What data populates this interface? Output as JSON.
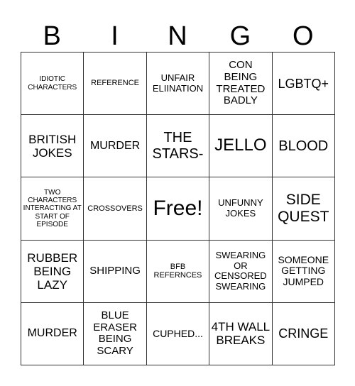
{
  "header": [
    "B",
    "I",
    "N",
    "G",
    "O"
  ],
  "rows": [
    [
      "IDIOTIC CHARACTERS",
      "REFERENCE",
      "UNFAIR ELIINATION",
      "CON BEING TREATED BADLY",
      "LGBTQ+"
    ],
    [
      "BRITISH JOKES",
      "MURDER",
      "THE STARS-",
      "JELLO",
      "BLOOD"
    ],
    [
      "TWO CHARACTERS INTERACTING AT START OF EPISODE",
      "CROSSOVERS",
      "Free!",
      "UNFUNNY JOKES",
      "SIDE QUEST"
    ],
    [
      "RUBBER BEING LAZY",
      "SHIPPING",
      "BFB REFERNCES",
      "SWEARING OR CENSORED SWEARING",
      "SOMEONE GETTING JUMPED"
    ],
    [
      "MURDER",
      "BLUE ERASER BEING SCARY",
      "CUPHED...",
      "4TH WALL BREAKS",
      "CRINGE"
    ]
  ]
}
